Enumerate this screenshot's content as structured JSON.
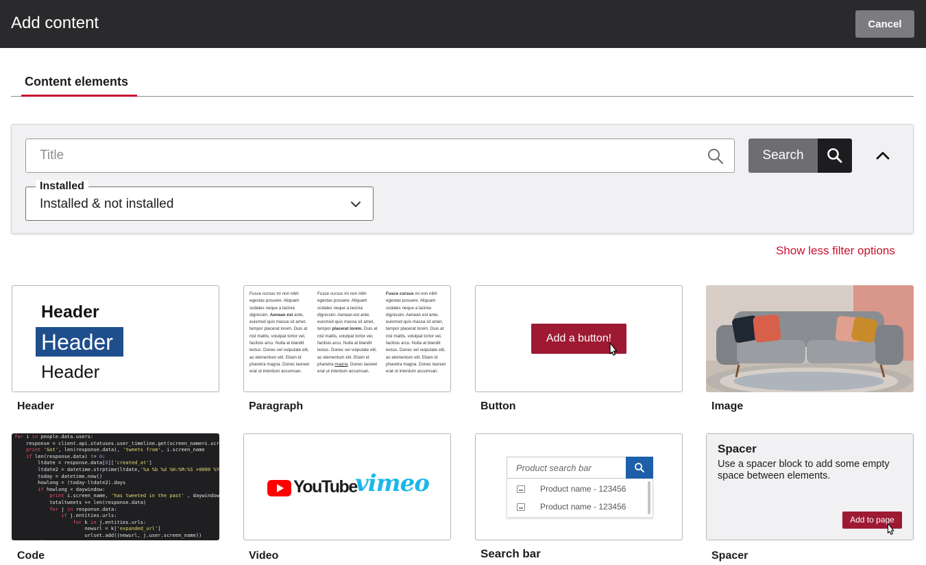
{
  "header": {
    "title": "Add content",
    "cancel_label": "Cancel"
  },
  "tabs": [
    {
      "label": "Content elements",
      "active": true
    }
  ],
  "filters": {
    "title_placeholder": "Title",
    "search_label": "Search",
    "installed_label": "Installed",
    "installed_value": "Installed & not installed",
    "toggle_link": "Show less filter options"
  },
  "cards": [
    {
      "name": "Header",
      "preview": {
        "h1": "Header",
        "h2": "Header",
        "h3": "Header"
      }
    },
    {
      "name": "Paragraph",
      "preview": {
        "col1": [
          "Fusce cursus mi non nibh egestas posuere. Aliquam sodales neque a lacinia dignissim. ",
          "Aenean est",
          " ante, euismod quis massa sit amet, tempor placerat lorem. Duis at nisl mattis, volutpat tortor vel, facilisis arcu. Nulla at blandit lectus. Donec vel vulputate elit, ac elementum elit. Etiam id pharetra magna. Donec laoreet erat ut interdum accumsan."
        ],
        "col2": [
          "Fusce cursus mi non nibh egestas posuere. Aliquam sodales neque a lacinia dignissim. Aenean est ante, euismod quis massa sit amet, tempor ",
          "placerat lorem.",
          " Duis at nisl mattis, volutpat tortor vel, facilisis arcu. Nulla at blandit lectus. Donec vel vulputate elit, ac elementum elit. Etiam id pharetra ",
          "magna",
          ". Donec laoreet erat ut interdum accumsan."
        ],
        "col3": [
          "Fusce cursus",
          " mi non nibh egestas posuere. Aliquam sodales neque a lacinia dignissim. Aenean est ante, euismod quis massa sit amet, tempor placerat lorem. Duis at nisl mattis, volutpat tortor vel, facilisis arcu. Nulla at blandit lectus. Donec vel vulputate elit, ac elementum elit. Etiam id pharetra magna. Donec laoreet erat ut interdum accumsan."
        ]
      }
    },
    {
      "name": "Button",
      "preview": {
        "button_label": "Add a button!"
      }
    },
    {
      "name": "Image"
    },
    {
      "name": "Code"
    },
    {
      "name": "Video",
      "preview": {
        "youtube": "YouTube",
        "vimeo": "vimeo"
      }
    },
    {
      "name": "Search bar",
      "preview": {
        "placeholder": "Product search bar",
        "results": [
          "Product name - 123456",
          "Product name - 123456"
        ]
      }
    },
    {
      "name": "Spacer",
      "preview": {
        "title": "Spacer",
        "description": "Use a spacer block to add some empty space between elements.",
        "button_label": "Add to page"
      }
    }
  ],
  "colors": {
    "accent": "#c8102e",
    "topbar": "#2a2a2d",
    "button_red": "#9d1a32"
  },
  "icons": [
    "search-icon",
    "chevron-up-icon",
    "chevron-down-icon",
    "pointer-cursor-icon",
    "image-placeholder-icon"
  ]
}
